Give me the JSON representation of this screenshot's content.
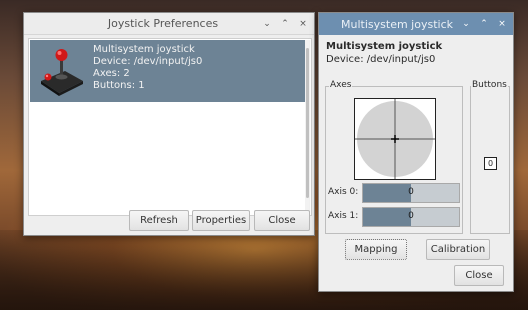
{
  "prefs_window": {
    "title": "Joystick Preferences",
    "controls": {
      "minimize": "⌄",
      "maximize": "⌃",
      "close": "×"
    },
    "devices": [
      {
        "name": "Multisystem joystick",
        "device": "Device: /dev/input/js0",
        "axes": "Axes: 2",
        "buttons": "Buttons: 1",
        "icon": "joystick-icon",
        "selected": true
      }
    ],
    "buttons": {
      "refresh": "Refresh",
      "properties": "Properties",
      "close": "Close"
    }
  },
  "multi_window": {
    "title": "Multisystem joystick",
    "controls": {
      "minimize": "⌄",
      "maximize": "⌃",
      "close": "×"
    },
    "name": "Multisystem joystick",
    "device": "Device: /dev/input/js0",
    "axes_label": "Axes",
    "buttons_label": "Buttons",
    "axis_rows": [
      {
        "label": "Axis 0:",
        "value": "0",
        "level": 0.5
      },
      {
        "label": "Axis 1:",
        "value": "0",
        "level": 0.5
      }
    ],
    "button_indicators": [
      {
        "value": "0"
      }
    ],
    "actions": {
      "mapping": "Mapping",
      "calibration": "Calibration",
      "close": "Close"
    }
  },
  "colors": {
    "selection": "#6d8395",
    "active_titlebar": "#6d8fb0",
    "pad_circle": "#d3d3d3"
  }
}
